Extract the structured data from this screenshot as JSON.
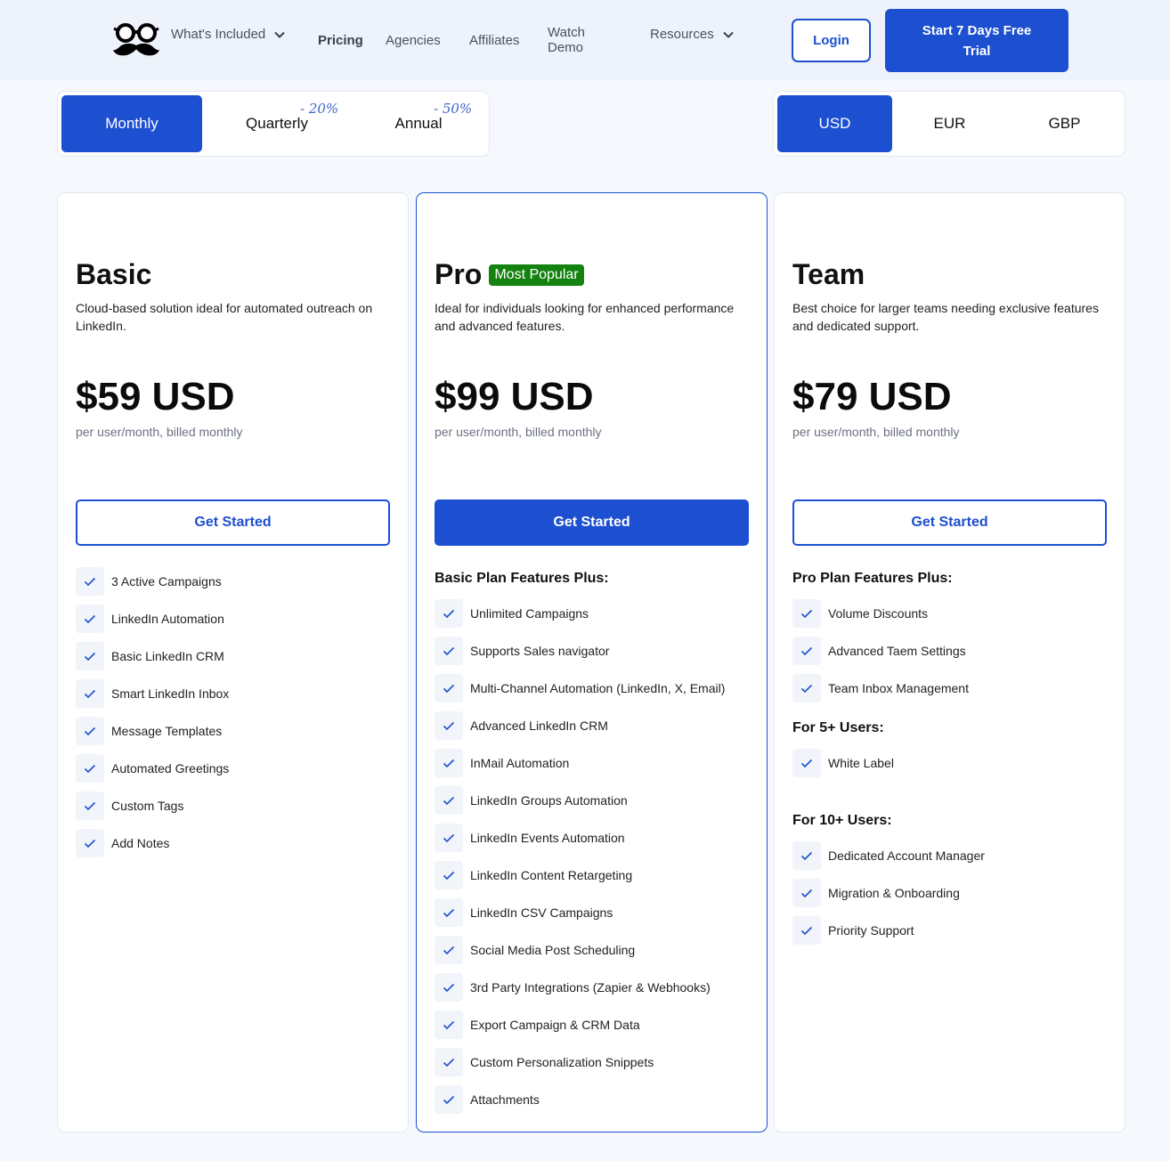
{
  "nav": {
    "logo_icon": "mustache-glasses-logo",
    "whats_included": "What's Included",
    "pricing": "Pricing",
    "agencies": "Agencies",
    "affiliates": "Affiliates",
    "watch_demo_line1": "Watch",
    "watch_demo_line2": "Demo",
    "resources": "Resources",
    "login": "Login",
    "trial": "Start 7 Days Free Trial"
  },
  "period_toggle": {
    "monthly": "Monthly",
    "quarterly": "Quarterly",
    "annual": "Annual",
    "quarterly_discount": "- 20%",
    "annual_discount": "- 50%",
    "selected": "Monthly"
  },
  "currency_toggle": {
    "usd": "USD",
    "eur": "EUR",
    "gbp": "GBP",
    "selected": "USD"
  },
  "plans": [
    {
      "name": "Basic",
      "description": "Cloud-based solution ideal for automated outreach on LinkedIn.",
      "price": "$59 USD",
      "billing": "per user/month, billed monthly",
      "cta": "Get Started",
      "features": [
        "3 Active Campaigns",
        "LinkedIn Automation",
        "Basic LinkedIn CRM",
        "Smart LinkedIn Inbox",
        "Message Templates",
        "Automated Greetings",
        "Custom Tags",
        "Add Notes"
      ]
    },
    {
      "name": "Pro",
      "badge": "Most Popular",
      "description": "Ideal for individuals looking for enhanced performance and advanced features.",
      "price": "$99 USD",
      "billing": "per user/month, billed monthly",
      "cta": "Get Started",
      "section_title": "Basic Plan Features Plus:",
      "features": [
        "Unlimited Campaigns",
        "Supports Sales navigator",
        "Multi-Channel Automation (LinkedIn, X, Email)",
        "Advanced LinkedIn CRM",
        "InMail Automation",
        "LinkedIn Groups Automation",
        "LinkedIn Events Automation",
        "LinkedIn Content Retargeting",
        "LinkedIn CSV Campaigns",
        "Social Media Post Scheduling",
        "3rd Party Integrations (Zapier & Webhooks)",
        "Export Campaign & CRM Data",
        "Custom Personalization Snippets",
        "Attachments"
      ]
    },
    {
      "name": "Team",
      "description": "Best choice for larger teams needing exclusive features and dedicated support.",
      "price": "$79 USD",
      "billing": "per user/month, billed monthly",
      "cta": "Get Started",
      "section_title": "Pro Plan Features Plus:",
      "features": [
        "Volume Discounts",
        "Advanced Taem Settings",
        "Team Inbox Management"
      ],
      "section2_title": "For 5+ Users:",
      "features2": [
        "White Label"
      ],
      "section3_title": "For 10+ Users:",
      "features3": [
        "Dedicated Account Manager",
        "Migration & Onboarding",
        "Priority Support"
      ]
    }
  ],
  "colors": {
    "accent": "#1d4fd1",
    "badge": "#13820f",
    "header_bg": "#eef2fa",
    "page_bg": "#f5f8fd"
  }
}
